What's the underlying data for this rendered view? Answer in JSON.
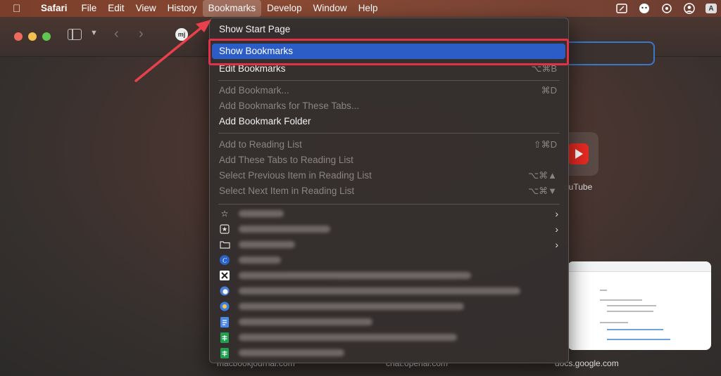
{
  "menubar": {
    "apple": "",
    "app": "Safari",
    "menus": [
      "File",
      "Edit",
      "View",
      "History",
      "Bookmarks",
      "Develop",
      "Window",
      "Help"
    ]
  },
  "toolbar": {
    "favicon": "mj"
  },
  "menu": {
    "items": [
      {
        "label": "Show Start Page",
        "shortcut": "",
        "enabled": true
      },
      {
        "label": "Show Bookmarks",
        "shortcut": "",
        "enabled": true,
        "highlighted": true
      },
      {
        "label": "Edit Bookmarks",
        "shortcut": "⌥⌘B",
        "enabled": true
      },
      {
        "label": "Add Bookmark...",
        "shortcut": "⌘D",
        "enabled": false
      },
      {
        "label": "Add Bookmarks for These Tabs...",
        "shortcut": "",
        "enabled": false
      },
      {
        "label": "Add Bookmark Folder",
        "shortcut": "",
        "enabled": true
      },
      {
        "label": "Add to Reading List",
        "shortcut": "⇧⌘D",
        "enabled": false
      },
      {
        "label": "Add These Tabs to Reading List",
        "shortcut": "",
        "enabled": false
      },
      {
        "label": "Select Previous Item in Reading List",
        "shortcut": "⌥⌘▲",
        "enabled": false
      },
      {
        "label": "Select Next Item in Reading List",
        "shortcut": "⌥⌘▼",
        "enabled": false
      }
    ],
    "bookmark_icons": [
      "star-icon",
      "star-square-icon",
      "folder-icon",
      "site-c-icon",
      "site-x-icon",
      "site-globe-icon",
      "site-sun-icon",
      "docs-icon",
      "sheets-icon",
      "sheets-icon"
    ]
  },
  "favorites": {
    "youtube_label": "ouTube"
  },
  "frequent": {
    "labels": [
      "macbookjournal.com",
      "chat.openai.com",
      "docs.google.com"
    ]
  },
  "colors": {
    "highlight": "#2c5cc5",
    "annotation": "#e0334a"
  }
}
